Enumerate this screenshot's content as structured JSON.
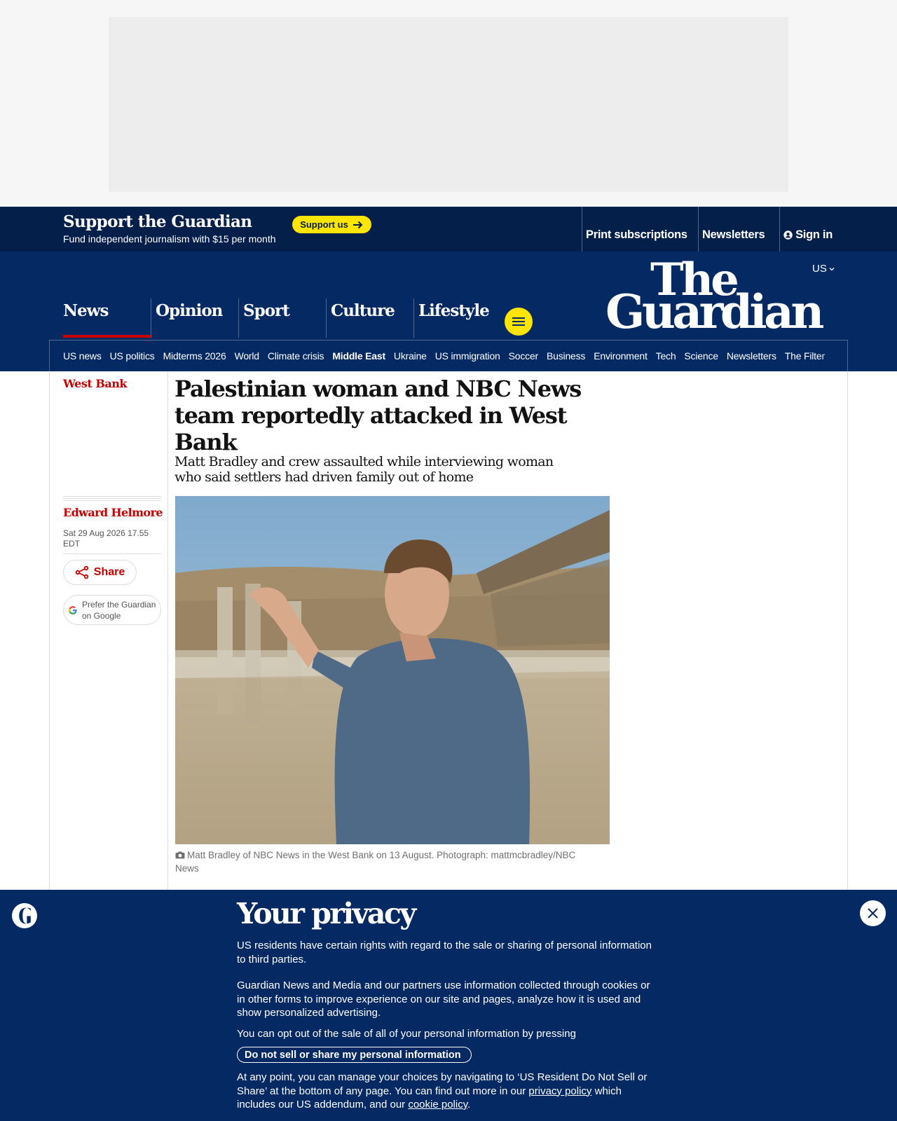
{
  "header": {
    "support_title": "Support the Guardian",
    "support_subtitle": "Fund independent journalism with $15 per month",
    "support_button": "Support us",
    "top_links": [
      "Print subscriptions",
      "Newsletters",
      "Sign in"
    ],
    "edition": "US",
    "logo_line1": "The",
    "logo_line2": "Guardian"
  },
  "nav": {
    "pillars": [
      "News",
      "Opinion",
      "Sport",
      "Culture",
      "Lifestyle"
    ],
    "active_pillar": "News",
    "subnav": [
      "US news",
      "US politics",
      "Midterms 2026",
      "World",
      "Climate crisis",
      "Middle East",
      "Ukraine",
      "US immigration",
      "Soccer",
      "Business",
      "Environment",
      "Tech",
      "Science",
      "Newsletters",
      "The Filter"
    ],
    "active_subnav": "Middle East"
  },
  "article": {
    "section": "West Bank",
    "headline": "Palestinian woman and NBC News team reportedly attacked in West Bank",
    "standfirst": "Matt Bradley and crew assaulted while interviewing woman who said settlers had driven family out of home",
    "byline": "Edward Helmore",
    "date": "Sat 29 Aug 2026 17.55 EDT",
    "share_label": "Share",
    "google_label": "Prefer the Guardian on Google",
    "caption": "Matt Bradley of NBC News in the West Bank on 13 August. Photograph: mattmcbradley/NBC News"
  },
  "privacy": {
    "title": "Your privacy",
    "p1": "US residents have certain rights with regard to the sale or sharing of personal information to third parties.",
    "p2": "Guardian News and Media and our partners use information collected through cookies or in other forms to improve experience on our site and pages, analyze how it is used and show personalized advertising.",
    "p3": "You can opt out of the sale of all of your personal information by pressing",
    "button": "Do not sell or share my personal information",
    "p4_part1": "At any point, you can manage your choices by navigating to ‘US Resident Do Not Sell or Share’ at the bottom of any page. You can find out more in our",
    "p4_link1": "privacy policy",
    "p4_part2": "which includes our US addendum, and our",
    "p4_link2": "cookie policy",
    "p4_end": "."
  },
  "colors": {
    "brand_blue": "#052962",
    "support_blue": "#041f4a",
    "news_red": "#c70000",
    "support_yellow": "#ffe500"
  },
  "icons": [
    "arrow-right-icon",
    "user-icon",
    "chevron-down-icon",
    "menu-icon",
    "share-icon",
    "google-icon",
    "camera-icon",
    "guardian-g-icon",
    "close-icon"
  ]
}
